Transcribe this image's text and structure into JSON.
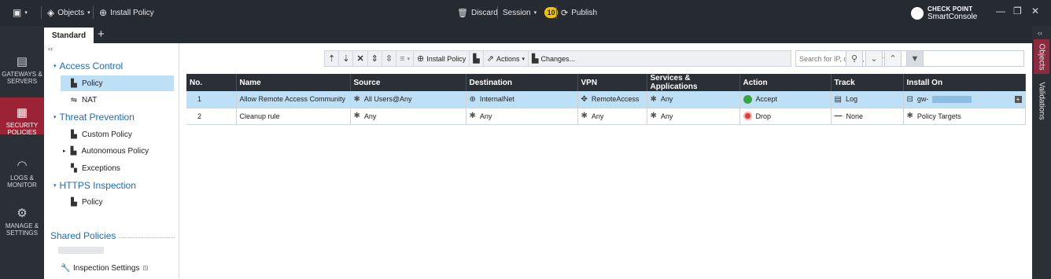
{
  "titlebar": {
    "objects_label": "Objects",
    "install_policy_label": "Install Policy",
    "discard_label": "Discard",
    "session_label": "Session",
    "session_count": "10",
    "publish_label": "Publish",
    "brand_top": "CHECK POINT",
    "brand_bottom": "SmartConsole"
  },
  "leftnav": {
    "items": [
      {
        "label": "GATEWAYS & SERVERS",
        "icon": "gateways-icon"
      },
      {
        "label": "SECURITY POLICIES",
        "icon": "security-policies-icon"
      },
      {
        "label": "LOGS & MONITOR",
        "icon": "logs-monitor-icon"
      },
      {
        "label": "MANAGE & SETTINGS",
        "icon": "manage-settings-icon"
      }
    ]
  },
  "tabs": {
    "active": "Standard",
    "add": "+"
  },
  "tree": {
    "access_control": "Access Control",
    "policy": "Policy",
    "nat": "NAT",
    "threat_prevention": "Threat Prevention",
    "custom_policy": "Custom Policy",
    "autonomous_policy": "Autonomous Policy",
    "exceptions": "Exceptions",
    "https_inspection": "HTTPS Inspection",
    "https_policy": "Policy",
    "shared_policies": "Shared Policies",
    "inspection_settings": "Inspection Settings"
  },
  "toolbar": {
    "install_policy": "Install Policy",
    "actions": "Actions",
    "changes": "Changes...",
    "search_placeholder": "Search for IP, object, action, ..."
  },
  "table": {
    "headers": [
      "No.",
      "Name",
      "Source",
      "Destination",
      "VPN",
      "Services & Applications",
      "Action",
      "Track",
      "Install On"
    ],
    "rows": [
      {
        "no": "1",
        "name": "Allow Remote Access Community",
        "source": "All Users@Any",
        "destination": "InternalNet",
        "vpn": "RemoteAccess",
        "services": "Any",
        "action": "Accept",
        "track": "Log",
        "install_on": "gw-"
      },
      {
        "no": "2",
        "name": "Cleanup rule",
        "source": "Any",
        "destination": "Any",
        "vpn": "Any",
        "services": "Any",
        "action": "Drop",
        "track": "None",
        "install_on": "Policy Targets"
      }
    ]
  },
  "rightbar": {
    "objects": "Objects",
    "validations": "Validations"
  },
  "colors": {
    "accent": "#1f6bb5",
    "active_nav": "#9b2335",
    "selected_row": "#bde0f7",
    "accept": "#37a53c",
    "drop": "#e23a3a",
    "session_badge": "#f2c300"
  }
}
